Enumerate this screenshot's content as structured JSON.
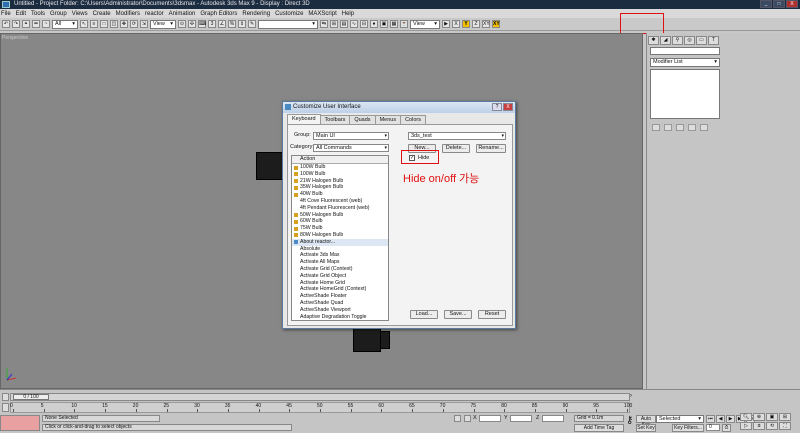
{
  "window": {
    "title": "Untitled      - Project Folder: C:\\Users\\Administrator\\Documents\\3dsmax      - Autodesk 3ds Max 9      - Display : Direct 3D",
    "controls": [
      "_",
      "□",
      "X"
    ]
  },
  "menu": [
    "File",
    "Edit",
    "Tools",
    "Group",
    "Views",
    "Create",
    "Modifiers",
    "reactor",
    "Animation",
    "Graph Editors",
    "Rendering",
    "Customize",
    "MAXScript",
    "Help"
  ],
  "toolbar": {
    "selection_filter": "All",
    "ref_coord": "View",
    "ref_coord2": "View",
    "axis_labels": [
      "X",
      "Y",
      "Z",
      "XY",
      "XY"
    ]
  },
  "viewport": {
    "label": "Perspective"
  },
  "command_panel": {
    "tabs": [
      "create-icon",
      "modify-icon",
      "hierarchy-icon",
      "motion-icon",
      "display-icon",
      "utilities-icon"
    ],
    "modifier_list": "Modifier List"
  },
  "dialog": {
    "title": "Customize User Interface",
    "title_buttons": [
      "?",
      "X"
    ],
    "tabs": [
      "Keyboard",
      "Toolbars",
      "Quads",
      "Menus",
      "Colors"
    ],
    "active_tab": "Keyboard",
    "group_label": "Group:",
    "group_value": "Main UI",
    "category_label": "Category:",
    "category_value": "All Commands",
    "shortcut_set": "3ds_test",
    "hide_label": "Hide",
    "list_header": "Action",
    "actions": [
      {
        "label": "100W Bulb",
        "icon": true
      },
      {
        "label": "100W Bulb",
        "icon": true
      },
      {
        "label": "21W Halogen Bulb",
        "icon": true
      },
      {
        "label": "35W Halogen Bulb",
        "icon": true
      },
      {
        "label": "40W Bulb",
        "icon": true
      },
      {
        "label": "4ft Cove Fluorescent (web)",
        "icon": false
      },
      {
        "label": "4ft Pendant Fluorescent (web)",
        "icon": false
      },
      {
        "label": "50W Halogen Bulb",
        "icon": true
      },
      {
        "label": "60W Bulb",
        "icon": true
      },
      {
        "label": "75W Bulb",
        "icon": true
      },
      {
        "label": "80W Halogen Bulb",
        "icon": true
      },
      {
        "label": "About reactor...",
        "icon": true
      },
      {
        "label": "Absolute",
        "icon": false
      },
      {
        "label": "Activate 3ds Max",
        "icon": false
      },
      {
        "label": "Activate All Maps",
        "icon": false
      },
      {
        "label": "Activate Grid (Context)",
        "icon": false
      },
      {
        "label": "Activate Grid Object",
        "icon": false
      },
      {
        "label": "Activate Home Grid",
        "icon": false
      },
      {
        "label": "Activate HomeGrid (Context)",
        "icon": false
      },
      {
        "label": "ActiveShade Floater",
        "icon": false
      },
      {
        "label": "ActiveShade Quad",
        "icon": false
      },
      {
        "label": "ActiveShade Viewport",
        "icon": false
      },
      {
        "label": "Adaptive Degradation Toggle",
        "icon": false
      }
    ],
    "buttons": {
      "new": "New...",
      "delete": "Delete...",
      "rename": "Rename...",
      "load": "Load...",
      "save": "Save...",
      "reset": "Reset"
    }
  },
  "annotation": "Hide on/off 가능",
  "timeline": {
    "slider": "0 / 100",
    "ticks": [
      "0",
      "5",
      "10",
      "15",
      "20",
      "25",
      "30",
      "35",
      "40",
      "45",
      "50",
      "55",
      "60",
      "65",
      "70",
      "75",
      "80",
      "85",
      "90",
      "95",
      "100"
    ]
  },
  "status": {
    "selection": "None Selected",
    "prompt": "Click or click-and-drag to select objects",
    "x_label": "X",
    "y_label": "Y",
    "z_label": "Z",
    "grid": "Grid = 0.1m",
    "add_time_tag": "Add Time Tag",
    "auto_key": "Auto Key",
    "set_key": "Set Key",
    "selected": "Selected",
    "key_filters": "Key Filters...",
    "frame": "0"
  },
  "colors": {
    "annotation": "#e01010",
    "title_bg": "#1b2b40"
  }
}
